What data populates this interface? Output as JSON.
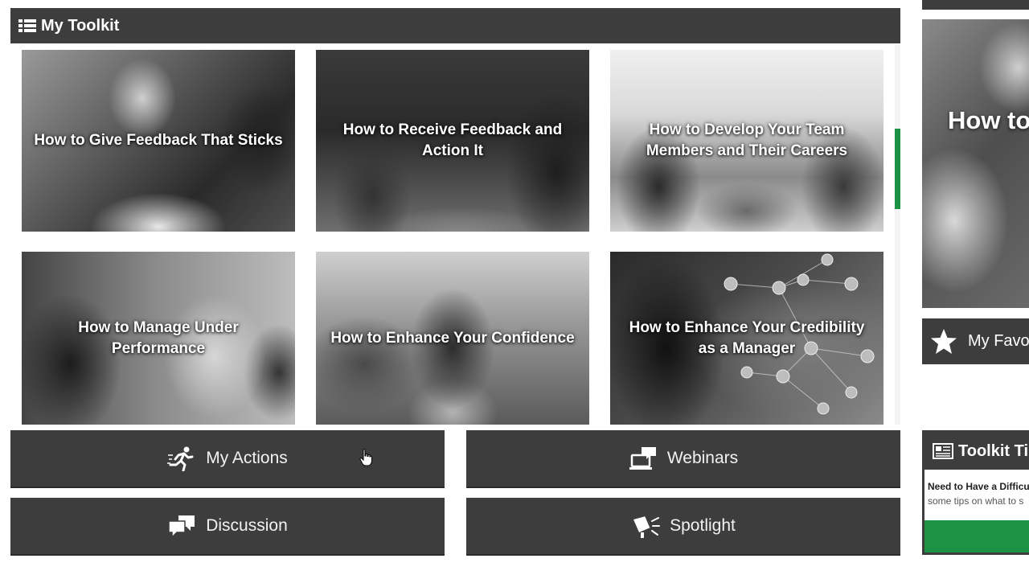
{
  "toolkit": {
    "header_title": "My Toolkit",
    "header_icon": "list-icon",
    "tiles": [
      {
        "title": "How to Give Feedback That Sticks"
      },
      {
        "title": "How to Receive Feedback and Action It"
      },
      {
        "title": "How to Develop Your Team Members and Their Careers"
      },
      {
        "title": "How to Manage Under Performance"
      },
      {
        "title": "How to Enhance Your Confidence"
      },
      {
        "title": "How to Enhance Your Credibility as a Manager"
      }
    ]
  },
  "actions": [
    {
      "label": "My Actions",
      "icon": "running-person-icon"
    },
    {
      "label": "Webinars",
      "icon": "laptop-chat-icon"
    },
    {
      "label": "Discussion",
      "icon": "chat-bubbles-icon"
    },
    {
      "label": "Spotlight",
      "icon": "spotlight-icon"
    }
  ],
  "right_column": {
    "banner_title": "How to",
    "favourites_label": "My Favo",
    "tips_title": "Toolkit Tip",
    "tips_question": "Need to Have a Difficul",
    "tips_text": "some tips on what to s"
  },
  "colors": {
    "header_bg": "#3d3d3d",
    "accent_green": "#1e9244",
    "text_light": "#ffffff"
  }
}
